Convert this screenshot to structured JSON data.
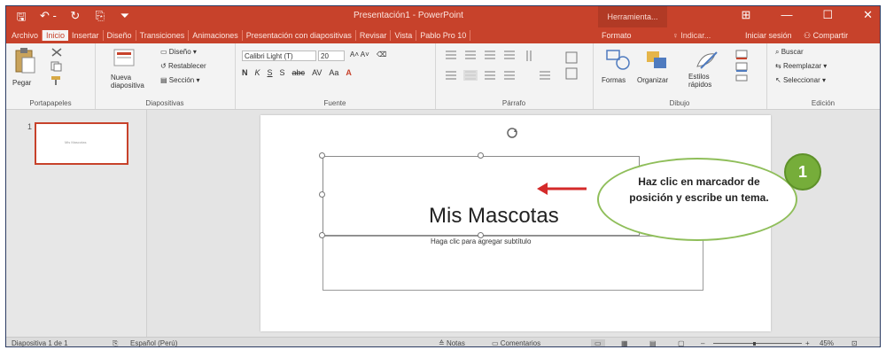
{
  "window": {
    "quick_access": [
      "🖫",
      "↶ -",
      "↻",
      "⎘",
      "⏷"
    ],
    "document_title": "Presentación1 - PowerPoint",
    "tools_title": "Herramienta...",
    "controls": [
      "⊞",
      "—",
      "☐",
      "✕"
    ]
  },
  "tabs": [
    {
      "label": "Archivo"
    },
    {
      "label": "Inicio"
    },
    {
      "label": "Insertar"
    },
    {
      "label": "Diseño"
    },
    {
      "label": "Transiciones"
    },
    {
      "label": "Animaciones"
    },
    {
      "label": "Presentación con diapositivas"
    },
    {
      "label": "Revisar"
    },
    {
      "label": "Vista"
    },
    {
      "label": "Pablo Pro 10"
    }
  ],
  "active_tab_index": 1,
  "tab_format": "Formato",
  "tell_me": "♀ Indicar...",
  "user": "Iniciar sesión",
  "share": "Compartir",
  "ribbon": {
    "clipboard": {
      "paste": "Pegar",
      "label": "Portapapeles"
    },
    "slides": {
      "new_slide": "Nueva diapositiva",
      "layout": "Diseño",
      "reset": "Restablecer",
      "section": "Sección",
      "label": "Diapositivas"
    },
    "font": {
      "font_name": "Calibri Light (T)",
      "font_size": "20",
      "label": "Fuente",
      "format_buttons": [
        "N",
        "K",
        "S",
        "S",
        "abc",
        "AV",
        "Aa",
        "A"
      ]
    },
    "paragraph": {
      "label": "Párrafo"
    },
    "drawing": {
      "shapes": "Formas",
      "arrange": "Organizar",
      "quick_styles": "Estilos rápidos",
      "label": "Dibujo"
    },
    "editing": {
      "find": "Buscar",
      "replace": "Reemplazar",
      "select": "Seleccionar",
      "label": "Edición"
    }
  },
  "thumbnails": [
    {
      "number": "1"
    }
  ],
  "slide": {
    "title": "Mis Mascotas",
    "subtitle_placeholder": "Haga clic para agregar subtítulo"
  },
  "callout": {
    "text": "Haz clic en marcador de posición y escribe un tema.",
    "badge": "1"
  },
  "status": {
    "slide_counter": "Diapositiva 1 de 1",
    "language": "Español (Perú)",
    "notes": "Notas",
    "comments": "Comentarios",
    "zoom": "45%"
  },
  "colors": {
    "accent": "#c7422b",
    "callout_border": "#8fbe5a",
    "badge": "#76ad3a"
  }
}
